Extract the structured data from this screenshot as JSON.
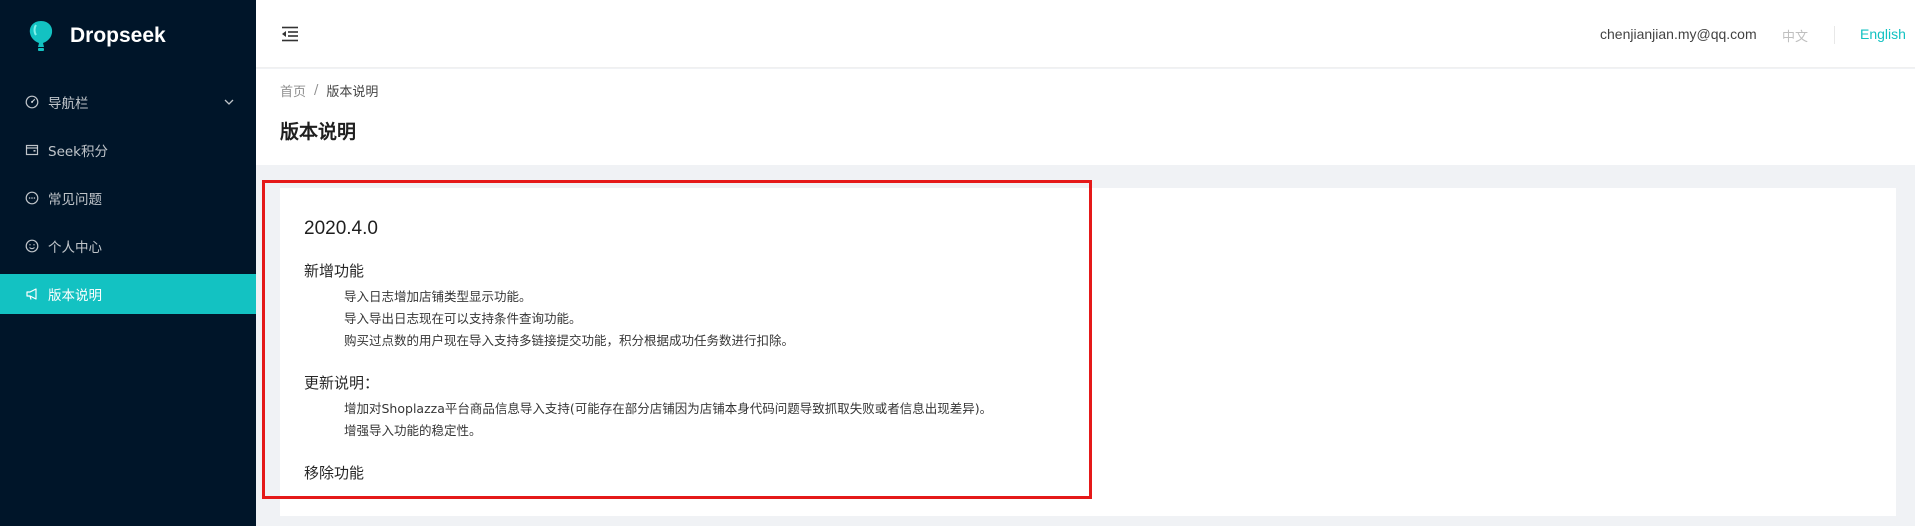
{
  "app": {
    "name": "Dropseek"
  },
  "sidebar": {
    "items": [
      {
        "label": "导航栏",
        "icon": "dashboard-icon",
        "has_submenu": true
      },
      {
        "label": "Seek积分",
        "icon": "wallet-icon"
      },
      {
        "label": "常见问题",
        "icon": "message-icon"
      },
      {
        "label": "个人中心",
        "icon": "smile-icon"
      },
      {
        "label": "版本说明",
        "icon": "notification-icon",
        "active": true
      }
    ]
  },
  "header": {
    "user_email": "chenjianjian.my@qq.com",
    "lang_zh": "中文",
    "lang_en": "English",
    "active_lang": "English"
  },
  "breadcrumb": {
    "home": "首页",
    "separator": "/",
    "current": "版本说明"
  },
  "page": {
    "title": "版本说明"
  },
  "release": {
    "version": "2020.4.0",
    "sections": [
      {
        "title": "新增功能",
        "items": [
          "导入日志增加店铺类型显示功能。",
          "导入导出日志现在可以支持条件查询功能。",
          "购买过点数的用户现在导入支持多链接提交功能，积分根据成功任务数进行扣除。"
        ]
      },
      {
        "title": "更新说明：",
        "items": [
          "增加对Shoplazza平台商品信息导入支持(可能存在部分店铺因为店铺本身代码问题导致抓取失败或者信息出现差异)。",
          "增强导入功能的稳定性。"
        ]
      },
      {
        "title": "移除功能",
        "items": []
      }
    ]
  },
  "colors": {
    "sidebar_bg": "#001529",
    "accent": "#13c2c2",
    "highlight_border": "#e51919"
  }
}
